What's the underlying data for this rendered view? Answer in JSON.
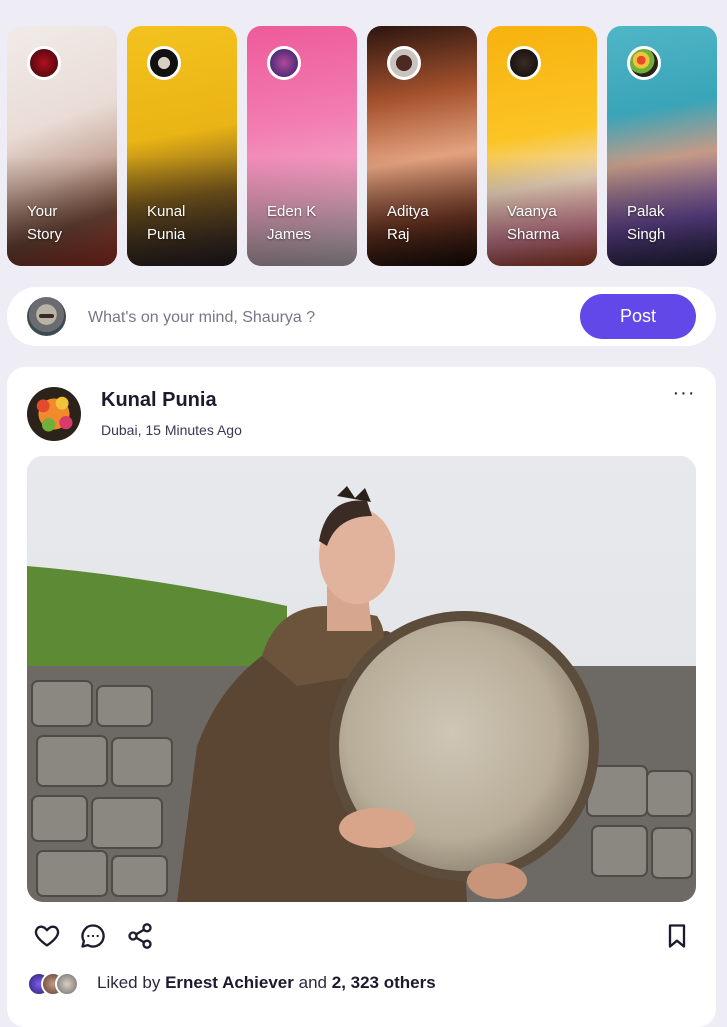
{
  "stories": [
    {
      "line1": "Your",
      "line2": "Story"
    },
    {
      "line1": "Kunal",
      "line2": "Punia"
    },
    {
      "line1": "Eden K",
      "line2": "James"
    },
    {
      "line1": "Aditya",
      "line2": "Raj"
    },
    {
      "line1": "Vaanya",
      "line2": "Sharma"
    },
    {
      "line1": "Palak",
      "line2": "Singh"
    }
  ],
  "composer": {
    "placeholder": "What's on your mind, Shaurya ?",
    "post_label": "Post"
  },
  "post": {
    "author": "Kunal Punia",
    "meta": "Dubai, 15 Minutes Ago",
    "more_label": "···",
    "likes": {
      "prefix": "Liked by",
      "name": "Ernest Achiever",
      "conj": "and",
      "count": "2, 323 others"
    }
  },
  "icons": {
    "like": "heart-icon",
    "comment": "comment-icon",
    "share": "share-icon",
    "save": "bookmark-icon",
    "more": "more-dots-icon"
  },
  "colors": {
    "accent": "#6248e8",
    "background": "#eeedf6"
  }
}
